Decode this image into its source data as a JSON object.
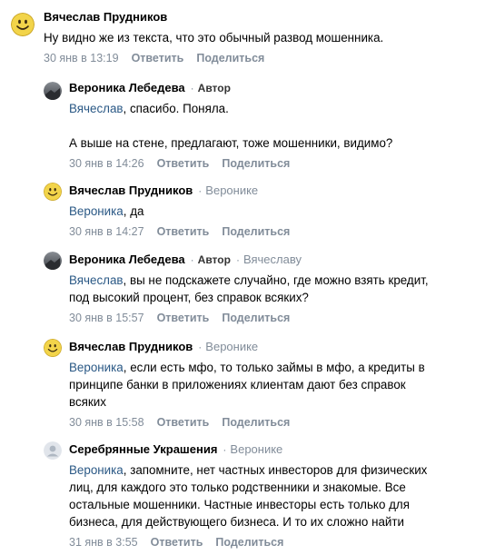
{
  "comments": [
    {
      "author": "Вячеслав Прудников",
      "avatar": "smiley-face",
      "badge": "",
      "reply_to": "",
      "mention": "",
      "text": "Ну видно же из текста, что это обычный развод мошенника.",
      "date": "30 янв в 13:19",
      "reply_label": "Ответить",
      "share_label": "Поделиться"
    },
    {
      "author": "Вероника Лебедева",
      "avatar": "photo",
      "badge": "Автор",
      "reply_to": "",
      "mention": "Вячеслав",
      "text": ", спасибо. Поняла.\n\nА выше на стене, предлагают, тоже мошенники, видимо?",
      "date": "30 янв в 14:26",
      "reply_label": "Ответить",
      "share_label": "Поделиться"
    },
    {
      "author": "Вячеслав Прудников",
      "avatar": "smiley-face",
      "badge": "",
      "reply_to": "Веронике",
      "mention": "Вероника",
      "text": ", да",
      "date": "30 янв в 14:27",
      "reply_label": "Ответить",
      "share_label": "Поделиться"
    },
    {
      "author": "Вероника Лебедева",
      "avatar": "photo",
      "badge": "Автор",
      "reply_to": "Вячеславу",
      "mention": "Вячеслав",
      "text": ", вы не подскажете случайно, где можно взять кредит,\nпод высокий процент, без справок всяких?",
      "date": "30 янв в 15:57",
      "reply_label": "Ответить",
      "share_label": "Поделиться"
    },
    {
      "author": "Вячеслав Прудников",
      "avatar": "smiley-face",
      "badge": "",
      "reply_to": "Веронике",
      "mention": "Вероника",
      "text": ", если есть мфо, то только займы в мфо, а кредиты в\nпринципе банки в приложениях клиентам дают без справок\nвсяких",
      "date": "30 янв в 15:58",
      "reply_label": "Ответить",
      "share_label": "Поделиться"
    },
    {
      "author": "Серебрянные Украшения",
      "avatar": "placeholder-person",
      "badge": "",
      "reply_to": "Веронике",
      "mention": "Вероника",
      "text": ", запомните, нет частных инвесторов для физических\nлиц, для каждого это только родственники и знакомые. Все\nостальные мошенники. Частные инвесторы есть только для\nбизнеса, для действующего бизнеса. И то их сложно найти",
      "date": "31 янв в 3:55",
      "reply_label": "Ответить",
      "share_label": "Поделиться"
    }
  ],
  "colors": {
    "link": "#2a5885",
    "secondary": "#818c99",
    "smiley": "#f2d44a"
  }
}
